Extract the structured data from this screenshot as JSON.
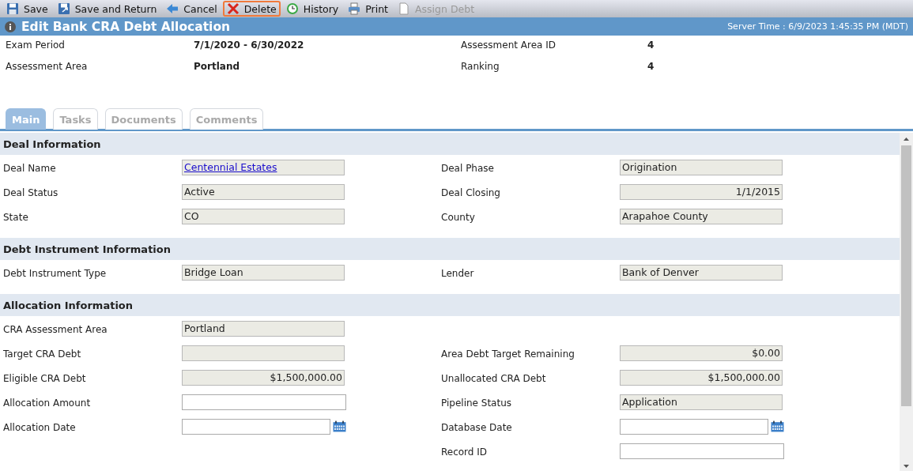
{
  "toolbar": [
    {
      "label": "Save",
      "kind": "save",
      "highlighted": false,
      "disabled": false
    },
    {
      "label": "Save and Return",
      "kind": "save_return",
      "highlighted": false,
      "disabled": false
    },
    {
      "label": "Cancel",
      "kind": "cancel",
      "highlighted": false,
      "disabled": false
    },
    {
      "label": "Delete",
      "kind": "delete",
      "highlighted": true,
      "disabled": false
    },
    {
      "label": "History",
      "kind": "history",
      "highlighted": false,
      "disabled": false
    },
    {
      "label": "Print",
      "kind": "print",
      "highlighted": false,
      "disabled": false
    },
    {
      "label": "Assign Debt",
      "kind": "document",
      "highlighted": false,
      "disabled": true
    }
  ],
  "header": {
    "title": "Edit Bank CRA Debt Allocation",
    "server_time": "Server Time : 6/9/2023 1:45:35 PM (MDT)"
  },
  "summary": [
    {
      "label": "Exam Period",
      "value": "7/1/2020 - 6/30/2022",
      "label2": "Assessment Area ID",
      "value2": "4"
    },
    {
      "label": "Assessment Area",
      "value": "Portland",
      "label2": "Ranking",
      "value2": "4"
    }
  ],
  "tabs": [
    {
      "label": "Main",
      "selected": true
    },
    {
      "label": "Tasks",
      "selected": false
    },
    {
      "label": "Documents",
      "selected": false
    },
    {
      "label": "Comments",
      "selected": false
    }
  ],
  "sections": [
    {
      "title": "Deal Information",
      "rows": [
        {
          "left": {
            "label": "Deal Name",
            "kind": "link",
            "value": "Centennial Estates"
          },
          "right": {
            "label": "Deal Phase",
            "kind": "readonly",
            "value": "Origination"
          }
        },
        {
          "left": {
            "label": "Deal Status",
            "kind": "readonly",
            "value": "Active"
          },
          "right": {
            "label": "Deal Closing",
            "kind": "number",
            "value": "1/1/2015"
          }
        },
        {
          "left": {
            "label": "State",
            "kind": "readonly",
            "value": "CO"
          },
          "right": {
            "label": "County",
            "kind": "readonly",
            "value": "Arapahoe County"
          }
        }
      ]
    },
    {
      "title": "Debt Instrument Information",
      "rows": [
        {
          "left": {
            "label": "Debt Instrument Type",
            "kind": "readonly",
            "value": "Bridge Loan"
          },
          "right": {
            "label": "Lender",
            "kind": "readonly",
            "value": "Bank of Denver"
          }
        }
      ]
    },
    {
      "title": "Allocation Information",
      "rows": [
        {
          "left": {
            "label": "CRA Assessment Area",
            "kind": "readonly",
            "value": "Portland"
          }
        },
        {
          "left": {
            "label": "Target CRA Debt",
            "kind": "readonly"
          },
          "right": {
            "label": "Area Debt Target Remaining",
            "kind": "number",
            "value": "$0.00"
          }
        },
        {
          "left": {
            "label": "Eligible CRA Debt",
            "kind": "number",
            "value": "$1,500,000.00"
          },
          "right": {
            "label": "Unallocated CRA Debt",
            "kind": "number",
            "value": "$1,500,000.00"
          }
        },
        {
          "left": {
            "label": "Allocation Amount",
            "kind": "input"
          },
          "right": {
            "label": "Pipeline Status",
            "kind": "readonly",
            "value": "Application"
          }
        },
        {
          "left": {
            "label": "Allocation Date",
            "kind": "date"
          },
          "right": {
            "label": "Database Date",
            "kind": "date"
          }
        },
        {
          "right": {
            "label": "Record ID",
            "kind": "input"
          }
        }
      ]
    }
  ]
}
